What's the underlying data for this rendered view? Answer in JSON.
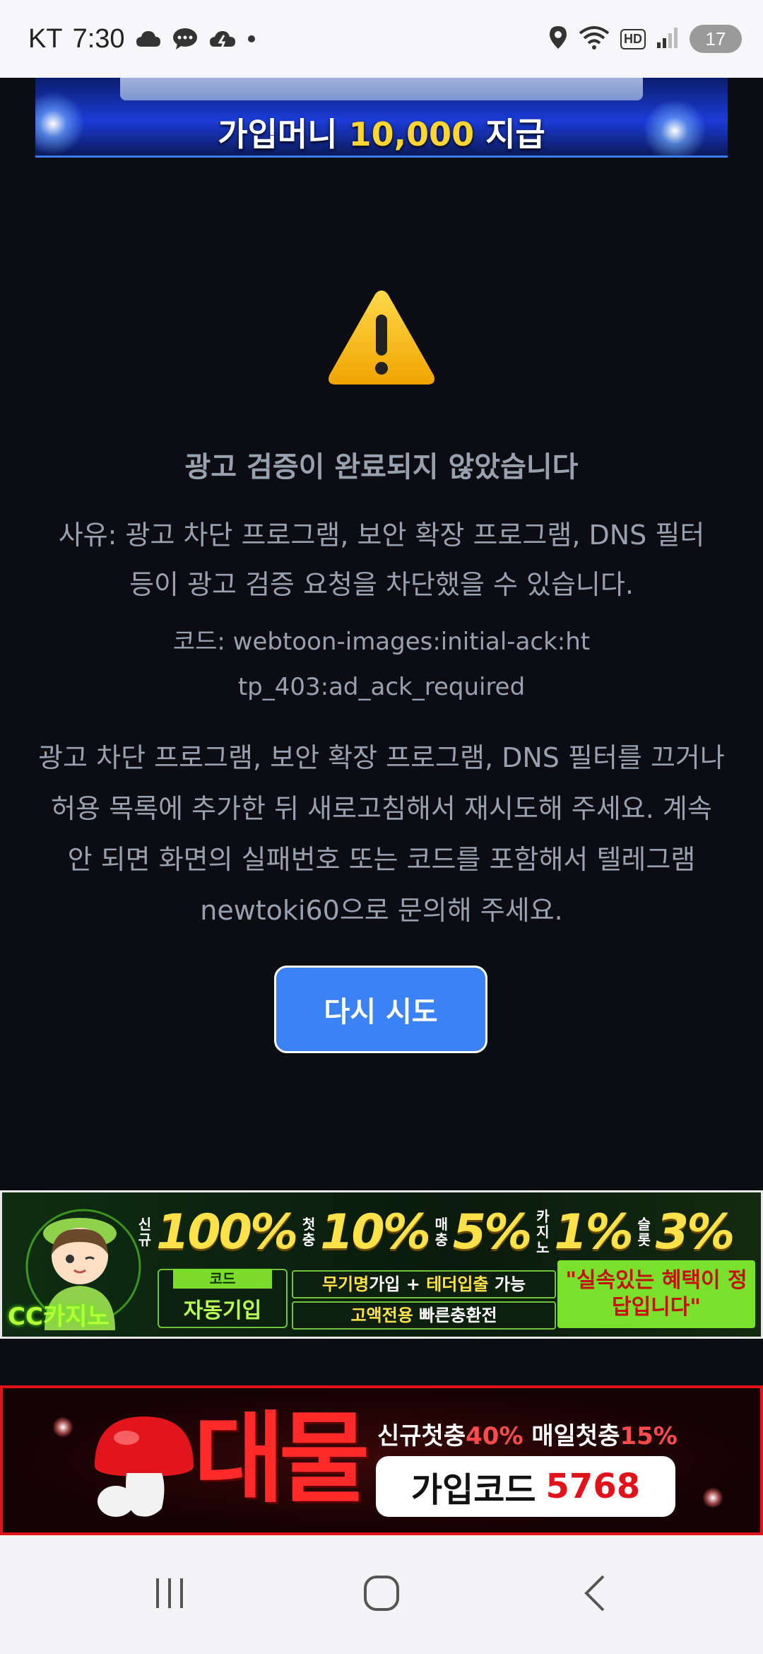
{
  "status_bar": {
    "carrier": "KT",
    "time": "7:30",
    "network_badge": "HD",
    "battery_level": "17"
  },
  "top_banner": {
    "caption_prefix": "가입머니 ",
    "caption_amount": "10,000",
    "caption_suffix": " 지급"
  },
  "error": {
    "title": "광고 검증이 완료되지 않았습니다",
    "reason": "사유: 광고 차단 프로그램, 보안 확장 프로그램, DNS 필터 등이 광고 검증 요청을 차단했을 수 있습니다.",
    "code": "코드: webtoon-images:initial-ack:http_403:ad_ack_required",
    "help": "광고 차단 프로그램, 보안 확장 프로그램, DNS 필터를 끄거나 허용 목록에 추가한 뒤 새로고침해서 재시도해 주세요. 계속 안 되면 화면의 실패번호 또는 코드를 포함해서 텔레그램 newtoki60으로 문의해 주세요.",
    "retry_label": "다시 시도"
  },
  "ad_casino": {
    "brand": "CC카지노",
    "rates": [
      {
        "tag": "신규",
        "value": "100%"
      },
      {
        "tag": "첫충",
        "value": "10%"
      },
      {
        "tag": "매충",
        "value": "5%"
      },
      {
        "tag": "카지노",
        "value": "1%"
      },
      {
        "tag": "슬롯",
        "value": "3%"
      }
    ],
    "code_label": "코드",
    "code_text": "자동기입",
    "info_line_1_a": "무기명",
    "info_line_1_b": "가입 + ",
    "info_line_1_c": "테더입출",
    "info_line_1_d": " 가능",
    "info_line_2_a": "고액전용",
    "info_line_2_b": " 빠른충환전",
    "slogan": "\"실속있는 혜택이 정답입니다\""
  },
  "ad_mushroom": {
    "brand": "대물",
    "promo_a": "신규첫충",
    "promo_b": "40%",
    "promo_c": " 매일첫충",
    "promo_d": "15%",
    "code_label": "가입코드",
    "code_number": "5768"
  },
  "nav": {
    "recents_icon": "recents-icon",
    "home_icon": "home-icon",
    "back_icon": "back-icon"
  }
}
